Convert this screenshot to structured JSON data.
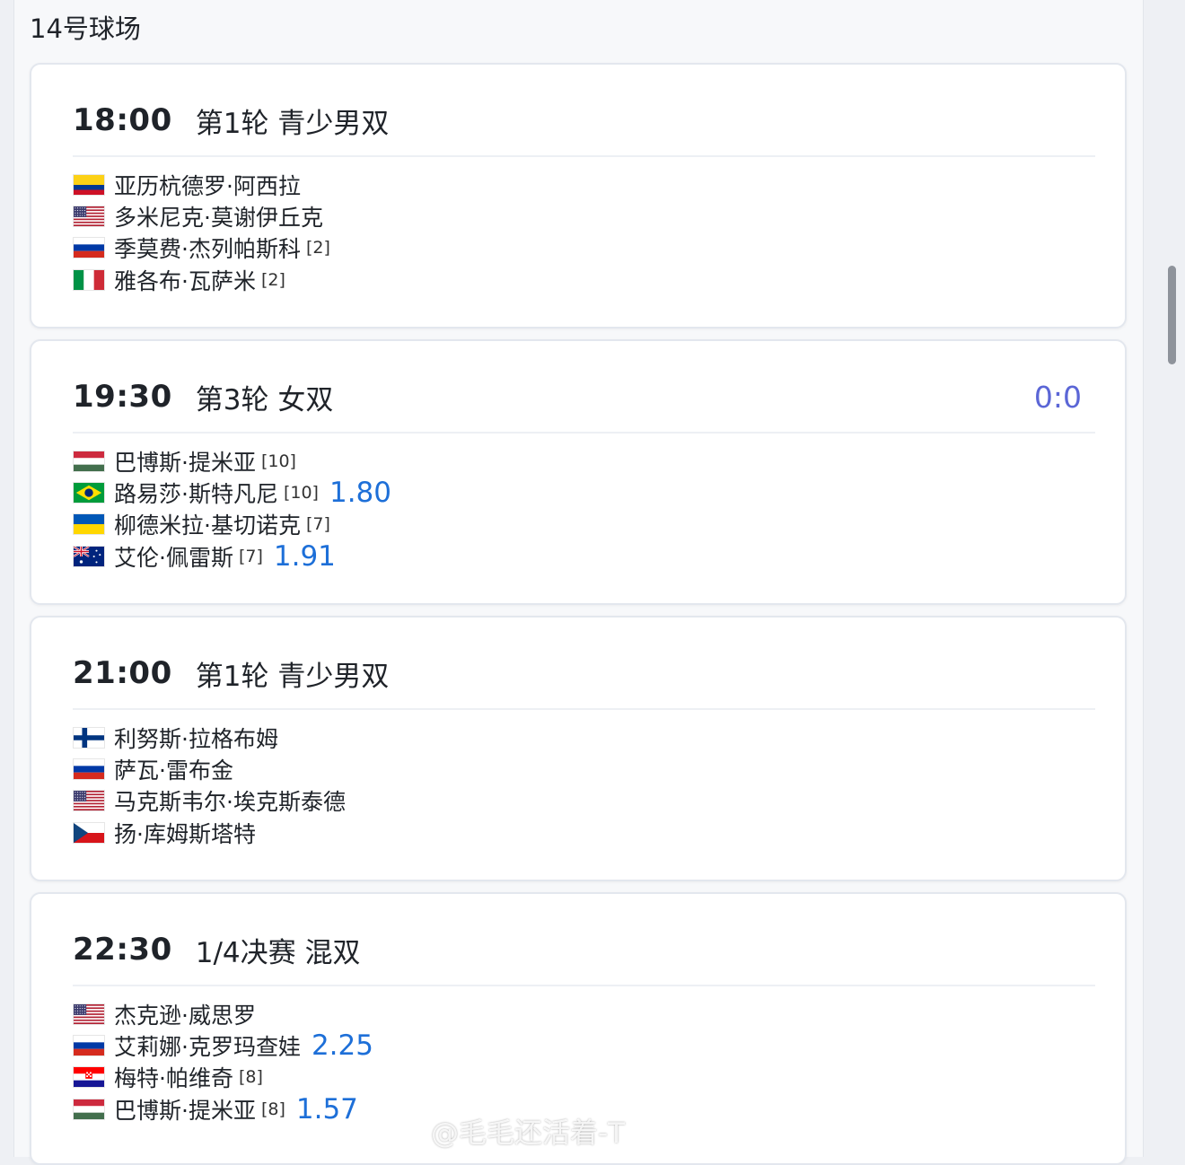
{
  "court": {
    "title": "14号球场"
  },
  "matches": [
    {
      "time": "18:00",
      "round": "第1轮",
      "event": "青少男双",
      "score": "",
      "players": [
        {
          "flag": "flag-colombia",
          "name": "亚历杭德罗·阿西拉",
          "seed": "",
          "odds": ""
        },
        {
          "flag": "flag-usa",
          "name": "多米尼克·莫谢伊丘克",
          "seed": "",
          "odds": ""
        },
        {
          "flag": "flag-russia",
          "name": "季莫费·杰列帕斯科",
          "seed": "[2]",
          "odds": ""
        },
        {
          "flag": "flag-italy",
          "name": "雅各布·瓦萨米",
          "seed": "[2]",
          "odds": ""
        }
      ]
    },
    {
      "time": "19:30",
      "round": "第3轮",
      "event": "女双",
      "score": "0:0",
      "players": [
        {
          "flag": "flag-hungary",
          "name": "巴博斯·提米亚",
          "seed": "[10]",
          "odds": ""
        },
        {
          "flag": "flag-brazil",
          "name": "路易莎·斯特凡尼",
          "seed": "[10]",
          "odds": "1.80"
        },
        {
          "flag": "flag-ukraine",
          "name": "柳德米拉·基切诺克",
          "seed": "[7]",
          "odds": ""
        },
        {
          "flag": "flag-australia",
          "name": "艾伦·佩雷斯",
          "seed": "[7]",
          "odds": "1.91"
        }
      ]
    },
    {
      "time": "21:00",
      "round": "第1轮",
      "event": "青少男双",
      "score": "",
      "players": [
        {
          "flag": "flag-finland",
          "name": "利努斯·拉格布姆",
          "seed": "",
          "odds": ""
        },
        {
          "flag": "flag-russia",
          "name": "萨瓦·雷布金",
          "seed": "",
          "odds": ""
        },
        {
          "flag": "flag-usa",
          "name": "马克斯韦尔·埃克斯泰德",
          "seed": "",
          "odds": ""
        },
        {
          "flag": "flag-czech",
          "name": "扬·库姆斯塔特",
          "seed": "",
          "odds": ""
        }
      ]
    },
    {
      "time": "22:30",
      "round": "1/4决赛",
      "event": "混双",
      "score": "",
      "players": [
        {
          "flag": "flag-usa",
          "name": "杰克逊·威思罗",
          "seed": "",
          "odds": ""
        },
        {
          "flag": "flag-russia",
          "name": "艾莉娜·克罗玛查娃",
          "seed": "",
          "odds": "2.25"
        },
        {
          "flag": "flag-croatia",
          "name": "梅特·帕维奇",
          "seed": "[8]",
          "odds": ""
        },
        {
          "flag": "flag-hungary",
          "name": "巴博斯·提米亚",
          "seed": "[8]",
          "odds": "1.57"
        }
      ]
    }
  ],
  "watermark": {
    "text": "@毛毛还活着-T"
  },
  "colors": {
    "score": "#5b66d6",
    "odds": "#1d6fd8",
    "divider": "#edf0f4"
  }
}
